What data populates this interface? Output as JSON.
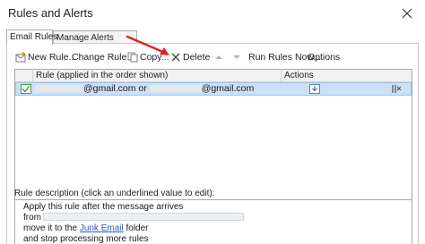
{
  "window": {
    "title": "Rules and Alerts"
  },
  "tabs": [
    {
      "label": "Email Rules",
      "active": true
    },
    {
      "label": "Manage Alerts",
      "active": false
    }
  ],
  "toolbar": {
    "new_rule": "New Rule...",
    "change_rule": "Change Rule",
    "copy": "Copy...",
    "delete": "Delete",
    "run_rules_now": "Run Rules Now...",
    "options": "Options"
  },
  "table": {
    "headers": {
      "rule": "Rule (applied in the order shown)",
      "actions": "Actions"
    },
    "rows": [
      {
        "checked": true,
        "part1": "@gmail.com or",
        "part2": "@gmail.com",
        "selected": true
      }
    ]
  },
  "description": {
    "label": "Rule description (click an underlined value to edit):",
    "line1": "Apply this rule after the message arrives",
    "line2_prefix": "from",
    "line3_prefix": "move it to the",
    "line3_link": "Junk Email",
    "line3_suffix": "folder",
    "line4": "and stop processing more rules"
  },
  "colors": {
    "selection": "#cce0f7",
    "annotation_arrow": "#e02424",
    "link": "#2a57c4",
    "check": "#4d9a46"
  }
}
